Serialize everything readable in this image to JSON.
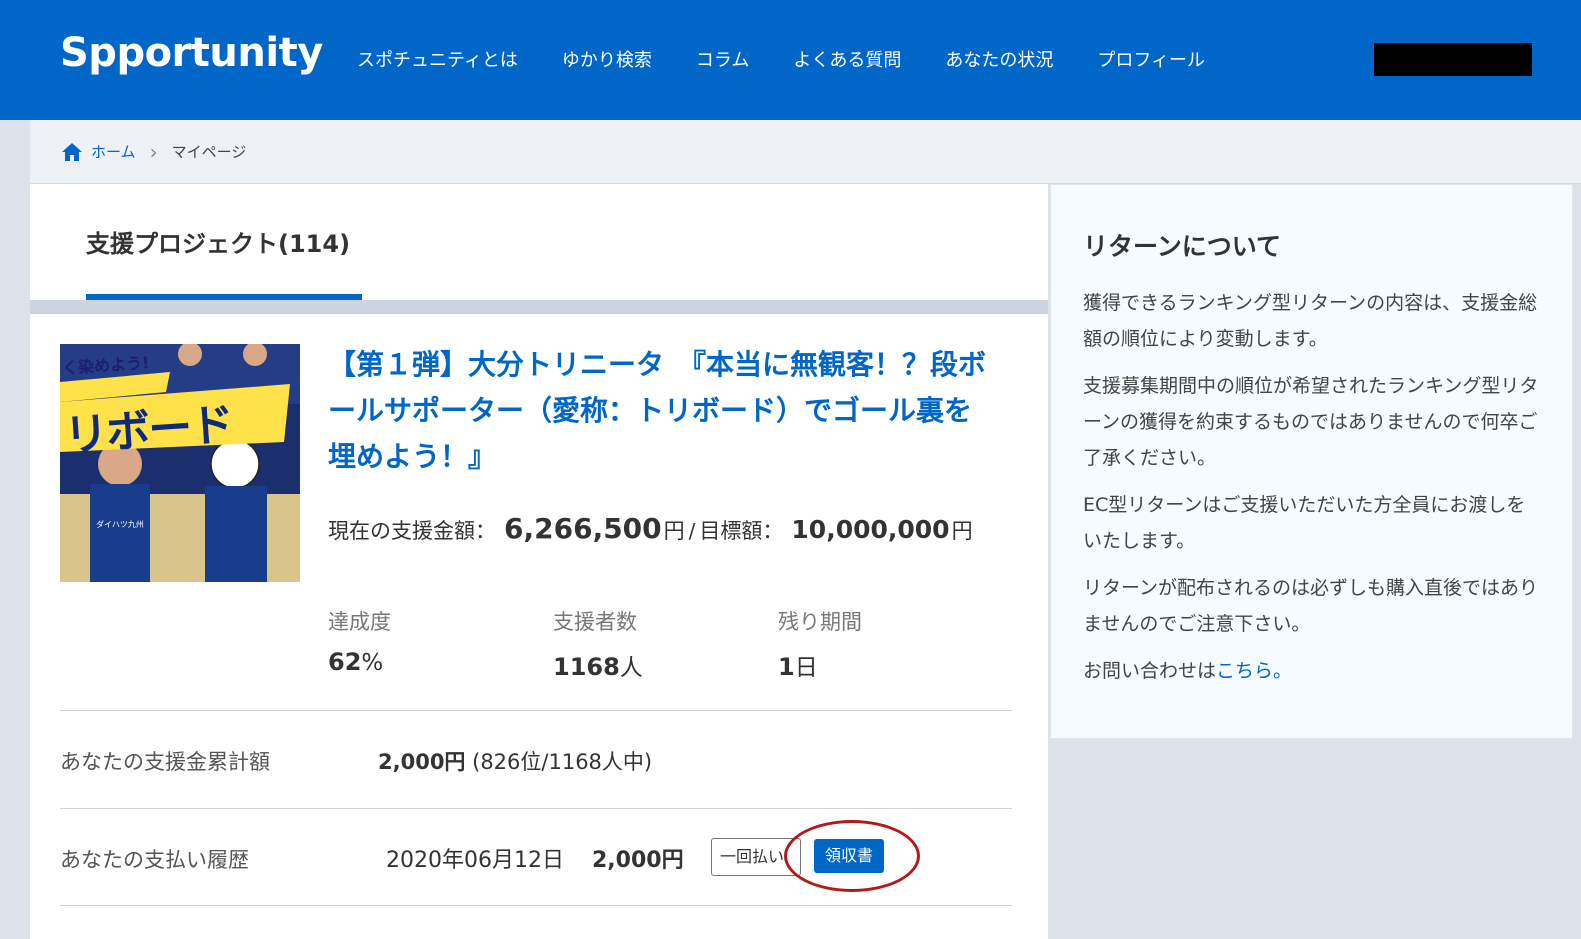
{
  "header": {
    "logo": "Spportunity",
    "nav": [
      "スポチュニティとは",
      "ゆかり検索",
      "コラム",
      "よくある質問",
      "あなたの状況",
      "プロフィール"
    ]
  },
  "breadcrumb": {
    "home": "ホーム",
    "current": "マイページ"
  },
  "tab": {
    "label": "支援プロジェクト(114)"
  },
  "project": {
    "thumbnail_text": [
      "く染めよう!",
      "リボード",
      "ダイハツ九州"
    ],
    "title": "【第１弾】大分トリニータ　『本当に無観客！？段ボールサポーター（愛称：トリボード）でゴール裏を埋めよう！』",
    "current_label": "現在の支援金額：",
    "current_amount": "6,266,500",
    "yen": "円",
    "slash": "/",
    "target_label": "目標額：",
    "target_amount": "10,000,000",
    "stats": [
      {
        "label": "達成度",
        "value": "62",
        "unit": "%"
      },
      {
        "label": "支援者数",
        "value": "1168",
        "unit": "人"
      },
      {
        "label": "残り期間",
        "value": "1",
        "unit": "日"
      }
    ]
  },
  "support": {
    "cumulative_label": "あなたの支援金累計額",
    "cumulative_amount": "2,000円",
    "rank": "(826位/1168人中)",
    "history_label": "あなたの支払い履歴",
    "history_date": "2020年06月12日",
    "history_amount": "2,000円",
    "payment_type": "一回払い",
    "receipt_button": "領収書"
  },
  "sidebar": {
    "title": "リターンについて",
    "paragraphs": [
      "獲得できるランキング型リターンの内容は、支援金総額の順位により変動します。",
      "支援募集期間中の順位が希望されたランキング型リターンの獲得を約束するものではありませんので何卒ご了承ください。",
      "EC型リターンはご支援いただいた方全員にお渡しをいたします。",
      "リターンが配布されるのは必ずしも購入直後ではありませんのでご注意下さい。"
    ],
    "contact_prefix": "お問い合わせは",
    "contact_link": "こちら。"
  },
  "colors": {
    "primary": "#0066c8",
    "highlight_circle": "#b21a1a",
    "redaction": "#000000"
  }
}
